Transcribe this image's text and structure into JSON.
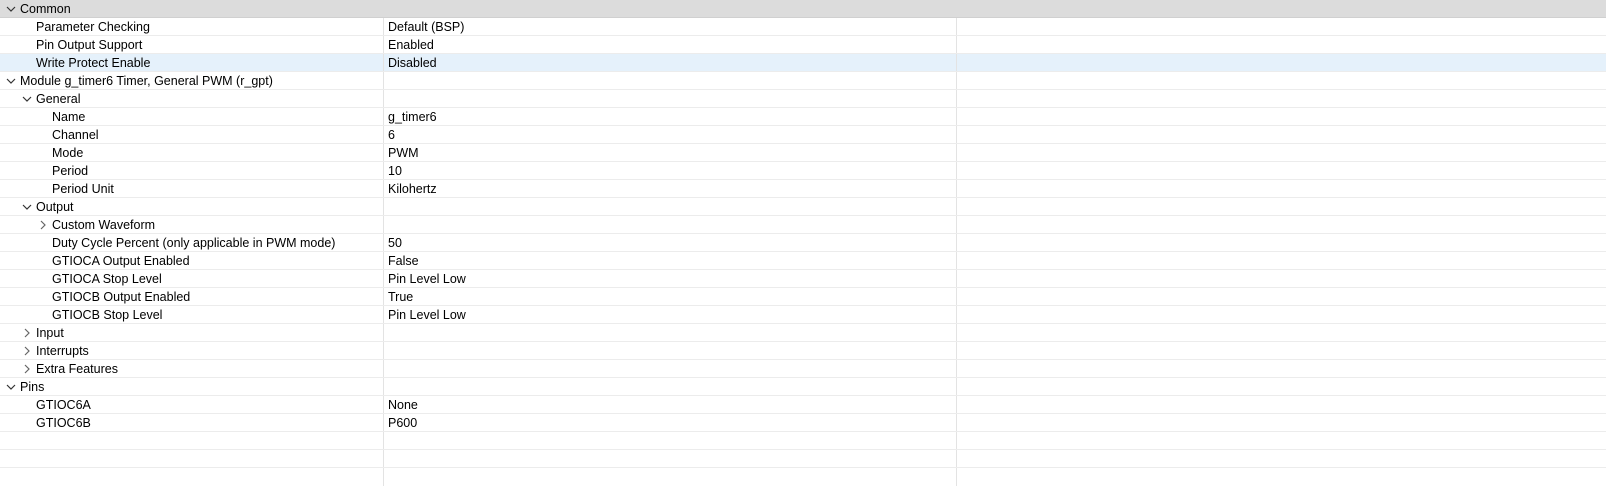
{
  "rows": [
    {
      "label": "Common",
      "value": ""
    },
    {
      "label": "Parameter Checking",
      "value": "Default (BSP)"
    },
    {
      "label": "Pin Output Support",
      "value": "Enabled"
    },
    {
      "label": "Write Protect Enable",
      "value": "Disabled"
    },
    {
      "label": "Module g_timer6 Timer, General PWM (r_gpt)",
      "value": ""
    },
    {
      "label": "General",
      "value": ""
    },
    {
      "label": "Name",
      "value": "g_timer6"
    },
    {
      "label": "Channel",
      "value": "6"
    },
    {
      "label": "Mode",
      "value": "PWM"
    },
    {
      "label": "Period",
      "value": "10"
    },
    {
      "label": "Period Unit",
      "value": "Kilohertz"
    },
    {
      "label": "Output",
      "value": ""
    },
    {
      "label": "Custom Waveform",
      "value": ""
    },
    {
      "label": "Duty Cycle Percent (only applicable in PWM mode)",
      "value": "50"
    },
    {
      "label": "GTIOCA Output Enabled",
      "value": "False"
    },
    {
      "label": "GTIOCA Stop Level",
      "value": "Pin Level Low"
    },
    {
      "label": "GTIOCB Output Enabled",
      "value": "True"
    },
    {
      "label": "GTIOCB Stop Level",
      "value": "Pin Level Low"
    },
    {
      "label": "Input",
      "value": ""
    },
    {
      "label": "Interrupts",
      "value": ""
    },
    {
      "label": "Extra Features",
      "value": ""
    },
    {
      "label": "Pins",
      "value": ""
    },
    {
      "label": "GTIOC6A",
      "value": "None"
    },
    {
      "label": "GTIOC6B",
      "value": "P600"
    }
  ],
  "icons": {
    "expanded": "chevron-down-icon",
    "collapsed": "chevron-right-icon"
  },
  "colors": {
    "header_bg": "#dcdcdc",
    "selected_bg": "#e5f1fb"
  }
}
